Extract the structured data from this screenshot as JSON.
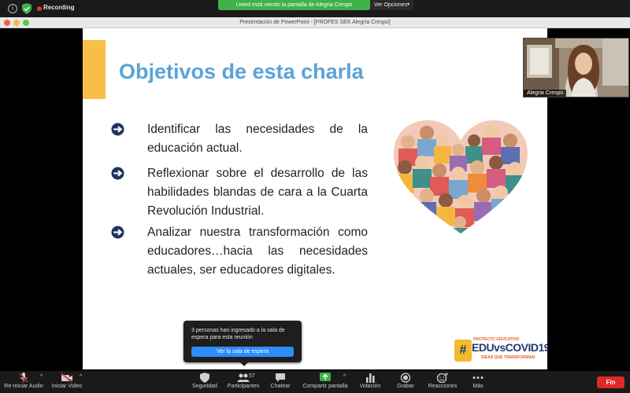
{
  "zoom_top": {
    "recording_label": "Recording",
    "share_banner": "Usted está viendo la pantalla de Alegria Crespo",
    "view_options": "Ver Opciones",
    "info_glyph": "i"
  },
  "window": {
    "title": "Presentación de PowerPoint - [PROFES SEK Alegría Crespo]"
  },
  "slide": {
    "title": "Objetivos de esta charla",
    "bullets": [
      "Identificar las necesidades de la educación actual.",
      "Reflexionar sobre el desarrollo de las habilidades blandas de cara a la Cuarta Revolución Industrial.",
      "Analizar nuestra transformación como educadores…hacia las necesidades actuales, ser educadores digitales."
    ],
    "logo": {
      "badge": "#",
      "top": "PROYECTO EDUCATIVO",
      "main": "EDUvsCOVID19",
      "sub": "IDEAS QUE TRANSFORMAN"
    }
  },
  "participant_video": {
    "name": "Alegria Crespo"
  },
  "waiting_popup": {
    "message": "3 personas han ingresado a la sala de espera para esta reunión",
    "button": "Ver la sala de espera"
  },
  "toolbar": {
    "audio": "Re-Iniciar Audio",
    "video": "Iniciar Video",
    "security": "Seguridad",
    "participants": "Participantes",
    "participants_count": "57",
    "chat": "Chatear",
    "share": "Compartir pantalla",
    "poll": "Votación",
    "record": "Grabar",
    "reactions": "Reacciones",
    "more": "Más",
    "end": "Fin",
    "caret": "^"
  },
  "colors": {
    "title_blue": "#5ba3d9",
    "accent_yellow": "#f7bf45",
    "share_green": "#3fb04a",
    "end_red": "#e02828",
    "popup_blue": "#2d8cff"
  }
}
